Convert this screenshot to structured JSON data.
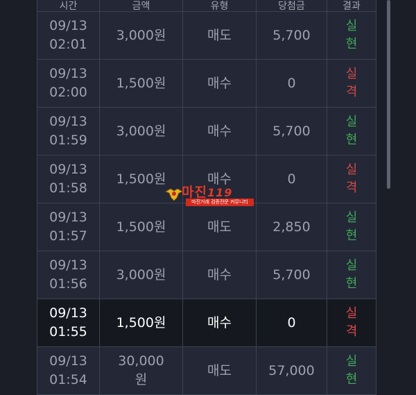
{
  "header": {
    "col1": "시간",
    "col2": "금액",
    "col3": "유형",
    "col4": "당첨금",
    "col5": "결과"
  },
  "rows": [
    {
      "date": "09/13",
      "time": "02:01",
      "amount": "3,000원",
      "type": "매도",
      "payout": "5,700",
      "result1": "실",
      "result2": "현",
      "status": "win"
    },
    {
      "date": "09/13",
      "time": "02:00",
      "amount": "1,500원",
      "type": "매수",
      "payout": "0",
      "result1": "실",
      "result2": "격",
      "status": "loss"
    },
    {
      "date": "09/13",
      "time": "01:59",
      "amount": "3,000원",
      "type": "매수",
      "payout": "5,700",
      "result1": "실",
      "result2": "현",
      "status": "win"
    },
    {
      "date": "09/13",
      "time": "01:58",
      "amount": "1,500원",
      "type": "매수",
      "payout": "0",
      "result1": "실",
      "result2": "격",
      "status": "loss"
    },
    {
      "date": "09/13",
      "time": "01:57",
      "amount": "1,500원",
      "type": "매도",
      "payout": "2,850",
      "result1": "실",
      "result2": "현",
      "status": "win"
    },
    {
      "date": "09/13",
      "time": "01:56",
      "amount": "3,000원",
      "type": "매수",
      "payout": "5,700",
      "result1": "실",
      "result2": "현",
      "status": "win"
    },
    {
      "date": "09/13",
      "time": "01:55",
      "amount": "1,500원",
      "type": "매수",
      "payout": "0",
      "result1": "실",
      "result2": "격",
      "status": "loss"
    },
    {
      "date": "09/13",
      "time": "01:54",
      "amount_line1": "30,000",
      "amount_line2": "원",
      "type": "매도",
      "payout": "57,000",
      "result1": "실",
      "result2": "현",
      "status": "win"
    }
  ],
  "watermark": {
    "brand": "마진",
    "suffix": "119",
    "tagline": "마진거래 검증전문 커뮤니티"
  },
  "colors": {
    "win": "#43a85a",
    "loss": "#cf4b4b",
    "background": "#1b1e27",
    "row": "#232736",
    "highlight_row": "#161820"
  },
  "icons": {
    "watermark_logo": "eagle-emblem-icon"
  }
}
